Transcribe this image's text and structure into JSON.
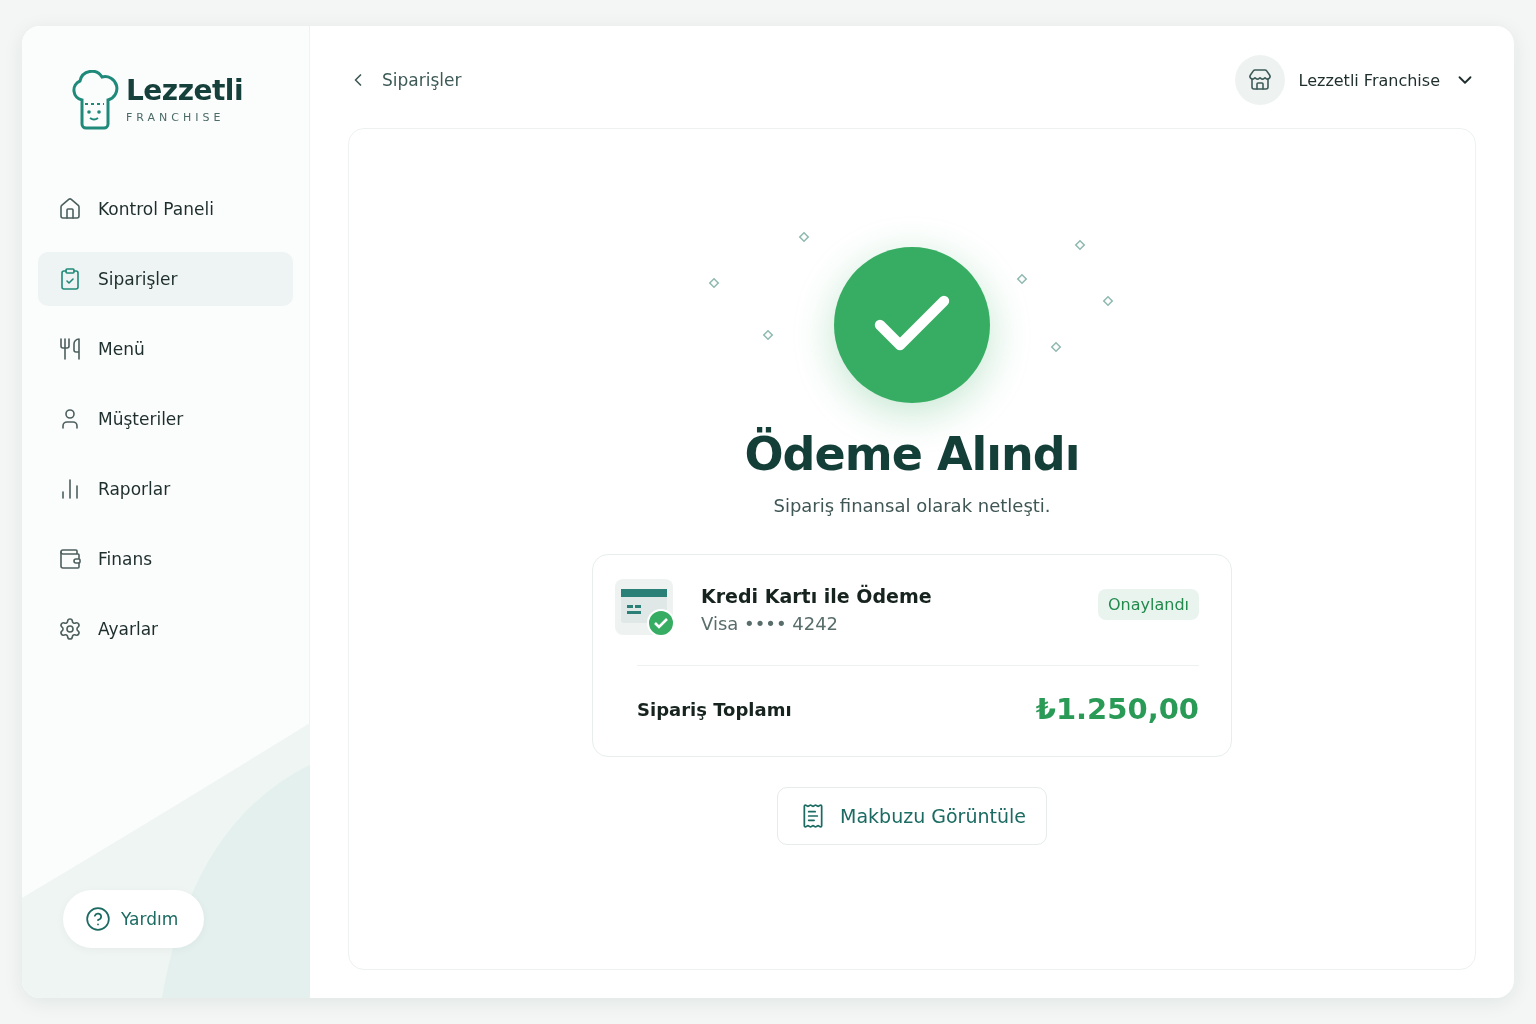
{
  "brand": {
    "name": "Lezzetli",
    "tagline": "FRANCHISE"
  },
  "sidebar": {
    "items": [
      {
        "label": "Kontrol Paneli",
        "selected": false
      },
      {
        "label": "Siparişler",
        "selected": true
      },
      {
        "label": "Menü",
        "selected": false
      },
      {
        "label": "Müşteriler",
        "selected": false
      },
      {
        "label": "Raporlar",
        "selected": false
      },
      {
        "label": "Finans",
        "selected": false
      },
      {
        "label": "Ayarlar",
        "selected": false
      }
    ],
    "help": "Yardım"
  },
  "header": {
    "back": "Siparişler",
    "account": "Lezzetli Franchise"
  },
  "success": {
    "title": "Ödeme Alındı",
    "subtitle": "Sipariş finansal olarak netleşti."
  },
  "payment": {
    "method": "Kredi Kartı ile Ödeme",
    "card": "Visa •••• 4242",
    "status": "Onaylandı",
    "total_label": "Sipariş Toplamı",
    "total": "₺1.250,00"
  },
  "action": "Makbuzu Görüntüle"
}
